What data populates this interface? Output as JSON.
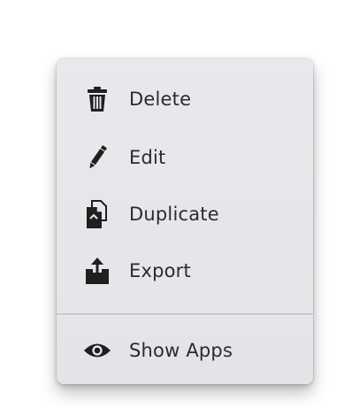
{
  "context_menu": {
    "items": [
      {
        "label": "Delete",
        "icon": "trash-icon"
      },
      {
        "label": "Edit",
        "icon": "pencil-icon"
      },
      {
        "label": "Duplicate",
        "icon": "duplicate-icon"
      },
      {
        "label": "Export",
        "icon": "export-icon"
      }
    ],
    "secondary_items": [
      {
        "label": "Show Apps",
        "icon": "eye-icon"
      }
    ]
  },
  "colors": {
    "menu_background": "#e5e7ea",
    "text": "#2b2b2b",
    "icon": "#1f1f1f",
    "divider": "#c6c8cb"
  }
}
